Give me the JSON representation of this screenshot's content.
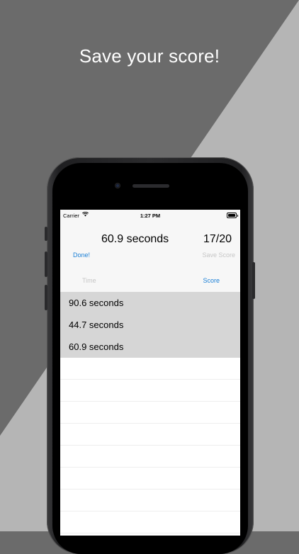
{
  "headline": "Save your score!",
  "status_bar": {
    "carrier": "Carrier",
    "time": "1:27 PM"
  },
  "header": {
    "current_time": "60.9 seconds",
    "current_score": "17/20",
    "done_label": "Done!",
    "save_label": "Save Score"
  },
  "tabs": {
    "time_label": "Time",
    "score_label": "Score",
    "active": "Score"
  },
  "list": {
    "items": [
      {
        "label": "90.6 seconds"
      },
      {
        "label": "44.7 seconds"
      },
      {
        "label": "60.9 seconds"
      }
    ]
  },
  "colors": {
    "accent": "#1a7fd6",
    "disabled": "#c6c6c6",
    "background_dark": "#6b6b6b",
    "background_light": "#b5b5b5"
  }
}
